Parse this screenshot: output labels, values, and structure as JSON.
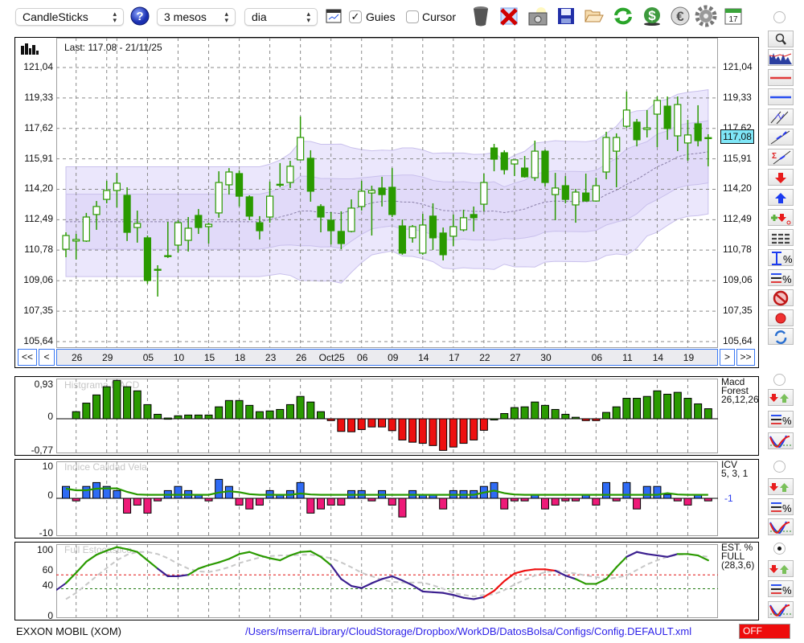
{
  "toolbar": {
    "chart_type": "CandleSticks",
    "period": "3 mesos",
    "interval": "dia",
    "guides_label": "Guies",
    "guides_checked": true,
    "cursor_label": "Cursor",
    "cursor_checked": false,
    "icons": [
      "help-icon",
      "chart-window-icon",
      "trash-icon",
      "delete-icon",
      "camera-icon",
      "save-icon",
      "folder-open-icon",
      "refresh-icon",
      "dollar-icon",
      "euro-icon",
      "gear-icon",
      "calendar-icon"
    ],
    "calendar_day": "17"
  },
  "main_chart": {
    "last_label": "Last: 117.08 - 21/11/25",
    "current_price_label": "117,08",
    "price_ticks": [
      "121,04",
      "119,33",
      "117,62",
      "115,91",
      "114,20",
      "112,49",
      "110,78",
      "109,06",
      "107,35",
      "105,64"
    ],
    "nav": {
      "first": "<<",
      "prev": "<",
      "next": ">",
      "last": ">>"
    }
  },
  "macd_panel": {
    "title": "Histgrama MACD",
    "ticks": [
      "0,93",
      "0",
      "-0,77"
    ],
    "legend": [
      "Macd",
      "Forest",
      "26,12,26"
    ]
  },
  "icv_panel": {
    "title": "Indice Calidad Vela",
    "ticks": [
      "10",
      "0",
      "-10"
    ],
    "legend": [
      "ICV",
      "5, 3, 1"
    ],
    "last_value": "-1"
  },
  "stoch_panel": {
    "title": "Full Estocastico",
    "ticks": [
      "100",
      "60",
      "40",
      "0"
    ],
    "legend": [
      "EST. %",
      "FULL",
      "(28,3,6)"
    ]
  },
  "status": {
    "instrument": "EXXON MOBIL (XOM)",
    "config_path": "/Users/mserra/Library/CloudStorage/Dropbox/WorkDB/DatosBolsa/Configs/Config.DEFAULT.xml",
    "state": "OFF"
  },
  "sidebar": {
    "main_tools": [
      "zoom-tool",
      "mini-chart-tool",
      "red-line-tool",
      "blue-line-tool",
      "channel-tool",
      "trend-line-tool",
      "sigma-trend-tool",
      "sell-signal-tool",
      "buy-signal-tool",
      "add-remove-signals-tool",
      "horizontal-lines-tool",
      "range-percent-tool",
      "lines-percent-tool",
      "clear-tool",
      "record-tool",
      "swap-tool"
    ],
    "panel_tools": [
      "signals-tool",
      "lines-percent-tool",
      "curves-tool"
    ],
    "panel_selected": 2
  },
  "colors": {
    "up_body": "#ffffff",
    "candle": "#2a9a00",
    "band_outer": "#ebe7fc",
    "band_inner": "#e1daf9",
    "macd_pos": "#2a9a00",
    "macd_neg": "#ee1010",
    "icv_pos": "#2f6bf5",
    "icv_neg": "#ee1a78",
    "stoch_green": "#2a9a00",
    "stoch_purple": "#3b1f8f",
    "stoch_red": "#ee1010",
    "stoch_d": "#c8c8c8",
    "level_hi": "#e01010",
    "level_lo": "#207a10",
    "price_box": "#7fe6f7",
    "path": "#2a1ee8",
    "off": "#ee0c0c"
  },
  "chart_data": {
    "type": "candlestick",
    "ylim": [
      105.64,
      121.04
    ],
    "x_labels": [
      {
        "label": "26",
        "index": 1
      },
      {
        "label": "29",
        "index": 4
      },
      {
        "label": "05",
        "index": 8
      },
      {
        "label": "10",
        "index": 11
      },
      {
        "label": "15",
        "index": 14
      },
      {
        "label": "18",
        "index": 17
      },
      {
        "label": "23",
        "index": 20
      },
      {
        "label": "26",
        "index": 23
      },
      {
        "label": "Oct25",
        "index": 26
      },
      {
        "label": "06",
        "index": 29
      },
      {
        "label": "09",
        "index": 32
      },
      {
        "label": "14",
        "index": 35
      },
      {
        "label": "17",
        "index": 38
      },
      {
        "label": "22",
        "index": 41
      },
      {
        "label": "27",
        "index": 44
      },
      {
        "label": "30",
        "index": 47
      },
      {
        "label": "06",
        "index": 52
      },
      {
        "label": "11",
        "index": 55
      },
      {
        "label": "14",
        "index": 58
      },
      {
        "label": "19",
        "index": 61
      }
    ],
    "grid_indices": [
      1,
      4,
      5,
      8,
      11,
      14,
      17,
      20,
      23,
      26,
      29,
      32,
      35,
      38,
      41,
      44,
      47,
      49,
      52,
      55,
      58,
      61
    ],
    "bollinger": {
      "period": 20,
      "inner_sigma": 1,
      "outer_sigma": 2
    },
    "ohlc": [
      [
        110.83,
        111.78,
        110.38,
        111.6
      ],
      [
        111.29,
        111.69,
        110.25,
        111.38
      ],
      [
        111.29,
        112.87,
        111.24,
        112.64
      ],
      [
        112.78,
        113.54,
        111.92,
        113.23
      ],
      [
        113.63,
        114.67,
        113.41,
        114.13
      ],
      [
        114.13,
        115.12,
        113.18,
        114.54
      ],
      [
        113.86,
        114.31,
        111.29,
        111.78
      ],
      [
        112.05,
        113.0,
        111.2,
        112.28
      ],
      [
        111.47,
        111.6,
        108.89,
        109.07
      ],
      [
        109.66,
        109.93,
        108.17,
        109.7
      ],
      [
        110.43,
        112.37,
        110.34,
        110.47
      ],
      [
        111.06,
        112.46,
        110.65,
        112.32
      ],
      [
        111.33,
        112.64,
        110.7,
        112.01
      ],
      [
        112.73,
        113.09,
        111.69,
        112.05
      ],
      [
        112.1,
        112.32,
        111.15,
        112.23
      ],
      [
        112.87,
        115.21,
        112.6,
        114.58
      ],
      [
        114.45,
        115.39,
        113.9,
        115.17
      ],
      [
        115.08,
        115.26,
        113.23,
        113.81
      ],
      [
        113.77,
        113.86,
        112.46,
        112.69
      ],
      [
        112.32,
        112.69,
        111.38,
        111.87
      ],
      [
        112.64,
        114.63,
        112.32,
        113.81
      ],
      [
        114.45,
        115.67,
        114.31,
        114.48
      ],
      [
        114.58,
        115.8,
        114.27,
        115.49
      ],
      [
        115.85,
        118.29,
        115.85,
        117.11
      ],
      [
        115.94,
        116.39,
        113.5,
        114.09
      ],
      [
        113.23,
        113.36,
        111.78,
        112.64
      ],
      [
        112.46,
        112.91,
        111.1,
        111.87
      ],
      [
        111.83,
        112.96,
        110.83,
        111.15
      ],
      [
        111.83,
        113.63,
        111.78,
        113.14
      ],
      [
        113.23,
        114.67,
        113.0,
        114.09
      ],
      [
        113.99,
        114.4,
        111.6,
        114.13
      ],
      [
        114.27,
        114.9,
        113.23,
        113.9
      ],
      [
        114.31,
        115.39,
        112.64,
        112.78
      ],
      [
        112.14,
        112.5,
        110.52,
        110.61
      ],
      [
        111.47,
        112.19,
        111.2,
        112.1
      ],
      [
        110.61,
        112.82,
        110.52,
        112.19
      ],
      [
        112.69,
        113.41,
        110.79,
        111.47
      ],
      [
        111.74,
        112.05,
        110.2,
        110.52
      ],
      [
        111.56,
        112.78,
        111.01,
        112.1
      ],
      [
        111.92,
        113.05,
        111.83,
        112.6
      ],
      [
        112.78,
        113.23,
        111.83,
        112.6
      ],
      [
        113.36,
        115.08,
        112.96,
        114.58
      ],
      [
        116.52,
        116.75,
        115.21,
        115.89
      ],
      [
        116.25,
        116.39,
        115.03,
        115.3
      ],
      [
        115.62,
        115.85,
        114.94,
        115.85
      ],
      [
        115.39,
        116.07,
        114.85,
        114.9
      ],
      [
        114.85,
        116.93,
        114.67,
        116.34
      ],
      [
        116.34,
        116.43,
        114.36,
        114.58
      ],
      [
        113.9,
        115.12,
        112.46,
        114.27
      ],
      [
        114.4,
        114.94,
        113.41,
        113.63
      ],
      [
        113.32,
        114.22,
        112.32,
        114.04
      ],
      [
        113.99,
        115.08,
        113.5,
        113.54
      ],
      [
        113.54,
        114.85,
        113.5,
        114.4
      ],
      [
        115.17,
        117.43,
        114.76,
        117.11
      ],
      [
        116.34,
        117.34,
        114.31,
        117.11
      ],
      [
        117.74,
        119.69,
        117.65,
        118.65
      ],
      [
        117.97,
        118.15,
        116.61,
        116.98
      ],
      [
        117.56,
        118.65,
        117.11,
        117.65
      ],
      [
        118.42,
        119.41,
        116.57,
        119.19
      ],
      [
        118.87,
        119.41,
        116.98,
        117.61
      ],
      [
        117.2,
        119.41,
        116.34,
        118.96
      ],
      [
        116.8,
        118.1,
        115.8,
        117.25
      ],
      [
        117.88,
        118.92,
        116.61,
        116.93
      ],
      [
        117.1,
        117.29,
        115.49,
        117.08
      ]
    ],
    "macd_hist": [
      null,
      0.19,
      0.42,
      0.64,
      0.86,
      1.03,
      0.86,
      0.75,
      0.38,
      0.12,
      0.02,
      0.08,
      0.1,
      0.1,
      0.1,
      0.32,
      0.49,
      0.49,
      0.36,
      0.19,
      0.21,
      0.25,
      0.38,
      0.6,
      0.45,
      0.19,
      -0.05,
      -0.34,
      -0.35,
      -0.29,
      -0.22,
      -0.22,
      -0.32,
      -0.57,
      -0.63,
      -0.66,
      -0.72,
      -0.85,
      -0.76,
      -0.66,
      -0.57,
      -0.31,
      0,
      0.14,
      0.3,
      0.32,
      0.45,
      0.36,
      0.25,
      0.12,
      0.04,
      -0.05,
      -0.05,
      0.17,
      0.32,
      0.55,
      0.55,
      0.6,
      0.75,
      0.66,
      0.71,
      0.55,
      0.4,
      0.27
    ],
    "macd_ylim": [
      -0.77,
      0.93
    ],
    "icv": [
      3.7,
      -0.8,
      3.7,
      4.9,
      3.7,
      2.4,
      -4.6,
      -2.1,
      -4.6,
      -0.8,
      2.4,
      3.7,
      2.4,
      1.2,
      -0.8,
      5.9,
      3.7,
      -2.1,
      -3.3,
      -2.1,
      2.4,
      1.2,
      2.4,
      4.9,
      -4.6,
      -3.3,
      -2.1,
      -2.1,
      2.4,
      2.4,
      -0.8,
      2.4,
      -2.1,
      -5.8,
      2.4,
      1.2,
      1.2,
      -3.3,
      2.4,
      2.4,
      2.4,
      3.7,
      4.9,
      -3.3,
      -0.8,
      -0.8,
      1.2,
      -3.3,
      -2.1,
      -0.8,
      -0.8,
      1.2,
      -2.1,
      4.9,
      -0.8,
      4.9,
      -3.3,
      3.7,
      3.7,
      1.2,
      -0.8,
      -2.1,
      1.2,
      -0.8
    ],
    "icv_signal": [
      3.0,
      2.5,
      2.5,
      3.0,
      3.1,
      3.1,
      2.0,
      1.2,
      1.1,
      1.1,
      1.1,
      1.1,
      1.1,
      1.1,
      1.1,
      1.8,
      2.2,
      1.9,
      1.3,
      1.1,
      1.1,
      1.1,
      1.1,
      1.5,
      1.2,
      1.1,
      1.1,
      1.1,
      1.1,
      1.1,
      1.1,
      1.1,
      1.1,
      1.1,
      1.1,
      1.1,
      1.1,
      1.1,
      1.1,
      1.1,
      1.1,
      1.8,
      2.4,
      1.6,
      1.2,
      1.1,
      1.1,
      1.1,
      1.1,
      1.1,
      1.1,
      1.1,
      1.1,
      1.1,
      1.1,
      1.1,
      1.1,
      1.1,
      1.1,
      1.6,
      1.2,
      1.1,
      1.1,
      1.1
    ],
    "icv_ylim": [
      -10,
      10
    ],
    "stoch_k": [
      48,
      63,
      79,
      89,
      95,
      100,
      97,
      93,
      81,
      69,
      58,
      58,
      60,
      69,
      74,
      78,
      83,
      90,
      93,
      88,
      84,
      81,
      88,
      93,
      94,
      86,
      74,
      54,
      44,
      41,
      48,
      54,
      58,
      52,
      45,
      36,
      35,
      34,
      31,
      27,
      25,
      28,
      37,
      51,
      62,
      66,
      68,
      68,
      66,
      59,
      54,
      47,
      47,
      54,
      71,
      86,
      93,
      90,
      88,
      86,
      90,
      90,
      88,
      81
    ],
    "stoch_k_zones": "gggggggggpppggggggggggggggppppppppppppppprrrrrrrppgggggpppppgggggggggg",
    "stoch_d": [
      25,
      34,
      46,
      58,
      70,
      81,
      89,
      93,
      93,
      90,
      84,
      76,
      69,
      65,
      64,
      67,
      71,
      77,
      81,
      85,
      87,
      88,
      88,
      89,
      89,
      87,
      84,
      78,
      71,
      63,
      58,
      53,
      50,
      49,
      49,
      49,
      45,
      40,
      34,
      31,
      29,
      31,
      32,
      38,
      46,
      53,
      59,
      64,
      66,
      64,
      62,
      59,
      57,
      54,
      56,
      59,
      67,
      75,
      81,
      86,
      89,
      90,
      88,
      86
    ],
    "stoch_levels": [
      60,
      40
    ],
    "stoch_ylim": [
      0,
      100
    ]
  }
}
